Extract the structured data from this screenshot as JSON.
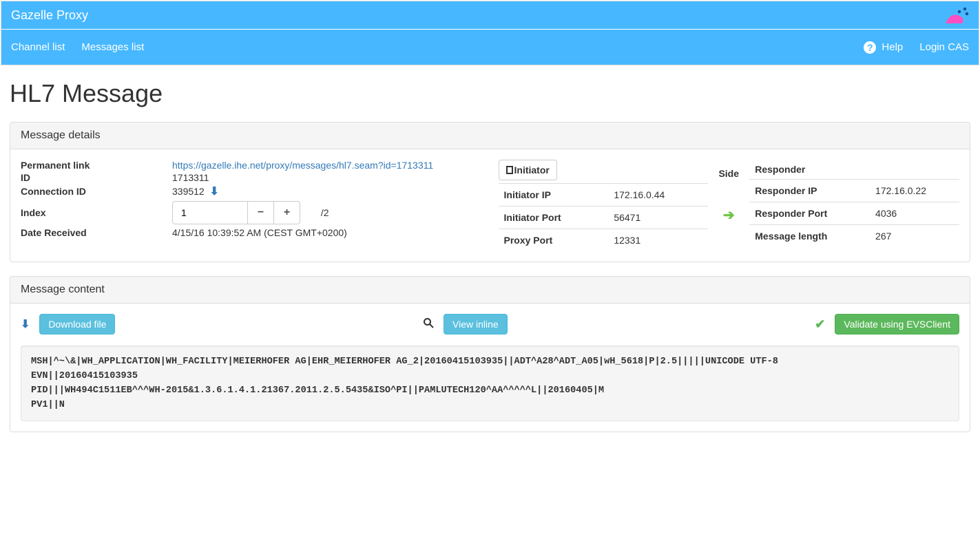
{
  "brand": "Gazelle Proxy",
  "nav": {
    "channel_list": "Channel list",
    "messages_list": "Messages list",
    "help": "Help",
    "login": "Login CAS"
  },
  "page_title": "HL7 Message",
  "panels": {
    "details_title": "Message details",
    "content_title": "Message content"
  },
  "details": {
    "labels": {
      "permanent_link": "Permanent link",
      "id": "ID",
      "connection_id": "Connection ID",
      "index": "Index",
      "date_received": "Date Received"
    },
    "permanent_link": "https://gazelle.ihe.net/proxy/messages/hl7.seam?id=1713311",
    "id": "1713311",
    "connection_id": "339512",
    "index_value": "1",
    "index_total": "/2",
    "date_received": "4/15/16 10:39:52 AM (CEST GMT+0200)"
  },
  "sides": {
    "initiator_header": "Initiator",
    "responder_header": "Responder",
    "side_header": "Side",
    "initiator": {
      "ip_label": "Initiator IP",
      "ip": "172.16.0.44",
      "port_label": "Initiator Port",
      "port": "56471",
      "proxy_port_label": "Proxy Port",
      "proxy_port": "12331"
    },
    "responder": {
      "ip_label": "Responder IP",
      "ip": "172.16.0.22",
      "port_label": "Responder Port",
      "port": "4036",
      "len_label": "Message length",
      "len": "267"
    }
  },
  "actions": {
    "download": "Download file",
    "view_inline": "View inline",
    "validate": "Validate using EVSClient"
  },
  "message_body": "MSH|^~\\&|WH_APPLICATION|WH_FACILITY|MEIERHOFER AG|EHR_MEIERHOFER AG_2|20160415103935||ADT^A28^ADT_A05|wH_5618|P|2.5|||||UNICODE UTF-8\nEVN||20160415103935\nPID|||WH494C1511EB^^^WH-2015&1.3.6.1.4.1.21367.2011.2.5.5435&ISO^PI||PAMLUTECH120^AA^^^^^L||20160405|M\nPV1||N"
}
